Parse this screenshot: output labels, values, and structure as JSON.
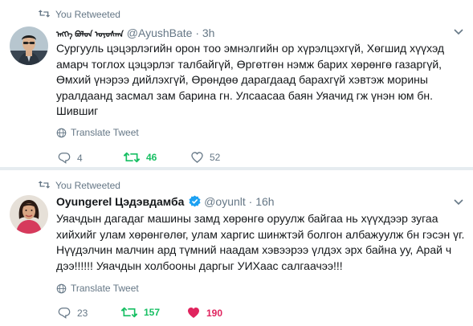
{
  "tweets": [
    {
      "retweet_label": "You Retweeted",
      "display_name": "ᠡᠩᠬᠡ ᠪᠣᠯᠳ ᠤᠶᠤᠰᠬᠠ",
      "handle": "@AyushBate",
      "dot": "·",
      "time": "3h",
      "verified": false,
      "lines": [
        "Сургууль цэцэрлэгийн орон тоо эмнэлгийн ор хүрэлцэхгүй, Хөгшид хүүхэд",
        "амарч тоглох цэцэрлэг талбайгүй, Өргөтгөн нэмж барих хөрөнгө газаргүй,",
        "Өмхий үнэрээ дийлэхгүй, Өрөндөө дарагдаад барахгүй хэвтэж морины",
        "уралдаанд засмал зам барина гн. Улсаасаа баян Уяачид гж үнэн юм бн.",
        "Шившиг"
      ],
      "translate": "Translate Tweet",
      "actions": {
        "replies": "4",
        "retweets": "46",
        "likes": "52"
      }
    },
    {
      "retweet_label": "You Retweeted",
      "display_name": "Oyungerel Цэдэвдамба",
      "handle": "@oyunlt",
      "dot": "·",
      "time": "16h",
      "verified": true,
      "lines": [
        "Уяачдын дагадаг машины замд хөрөнгө оруулж байгаа нь хүүхдээр зугаа",
        "хийхийг улам хөрөнгөлөг, улам харгис шинжтэй болгон албажуулж бн гэсэн үг.",
        "Нүүдэлчин малчин ард түмний наадам хэвээрээ үлдэх эрх байна уу, Арай ч",
        "дээ!!!!!! Уяачдын холбооны даргыг УИХаас салгаачээ!!!"
      ],
      "translate": "Translate Tweet",
      "actions": {
        "replies": "23",
        "retweets": "157",
        "likes": "190"
      }
    }
  ],
  "colors": {
    "muted": "#657786",
    "retweet_green": "#17bf63",
    "like_red": "#e0245e",
    "verified_blue": "#1da1f2",
    "text": "#14171a"
  }
}
